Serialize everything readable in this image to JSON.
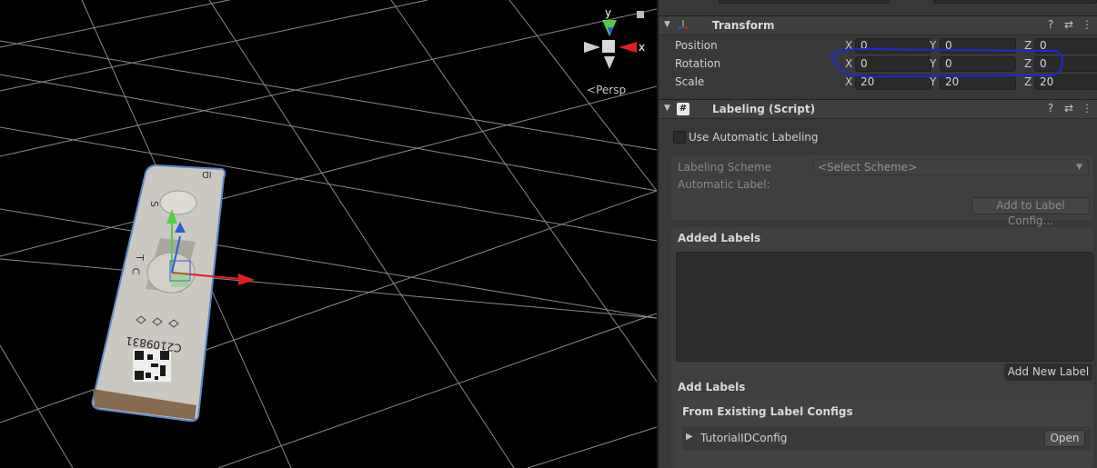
{
  "scene": {
    "view_mode_label": "Persp",
    "gizmo_axes": {
      "x_label": "x",
      "y_label": "y"
    },
    "object": {
      "letters": {
        "top": "ID",
        "s": "S",
        "t": "T",
        "c": "C"
      },
      "serial": "C2109831"
    }
  },
  "inspector": {
    "transform": {
      "title": "Transform",
      "rows": [
        {
          "label": "Position",
          "x": "0",
          "y": "0",
          "z": "0"
        },
        {
          "label": "Rotation",
          "x": "0",
          "y": "0",
          "z": "0"
        },
        {
          "label": "Scale",
          "x": "20",
          "y": "20",
          "z": "20"
        }
      ],
      "axis_labels": {
        "x": "X",
        "y": "Y",
        "z": "Z"
      }
    },
    "labeling": {
      "title": "Labeling (Script)",
      "use_automatic_label": "Use Automatic Labeling",
      "scheme_label": "Labeling Scheme",
      "scheme_value": "<Select Scheme>",
      "automatic_label": "Automatic Label:",
      "add_to_config_button": "Add to Label Config...",
      "added_labels_title": "Added Labels",
      "add_new_label_button": "Add New Label",
      "add_labels_title": "Add Labels",
      "existing_configs_title": "From Existing Label Configs",
      "config_name": "TutorialIDConfig",
      "open_button": "Open"
    }
  },
  "colors": {
    "annotation_outline": "#1a2bd6",
    "gizmo_x": "#e02020",
    "gizmo_y": "#50d040",
    "gizmo_z": "#2a5bd7"
  },
  "icons": {
    "help": "?",
    "presets": "⇄",
    "menu": "⋮",
    "fold": "▼",
    "expand": "▶"
  }
}
